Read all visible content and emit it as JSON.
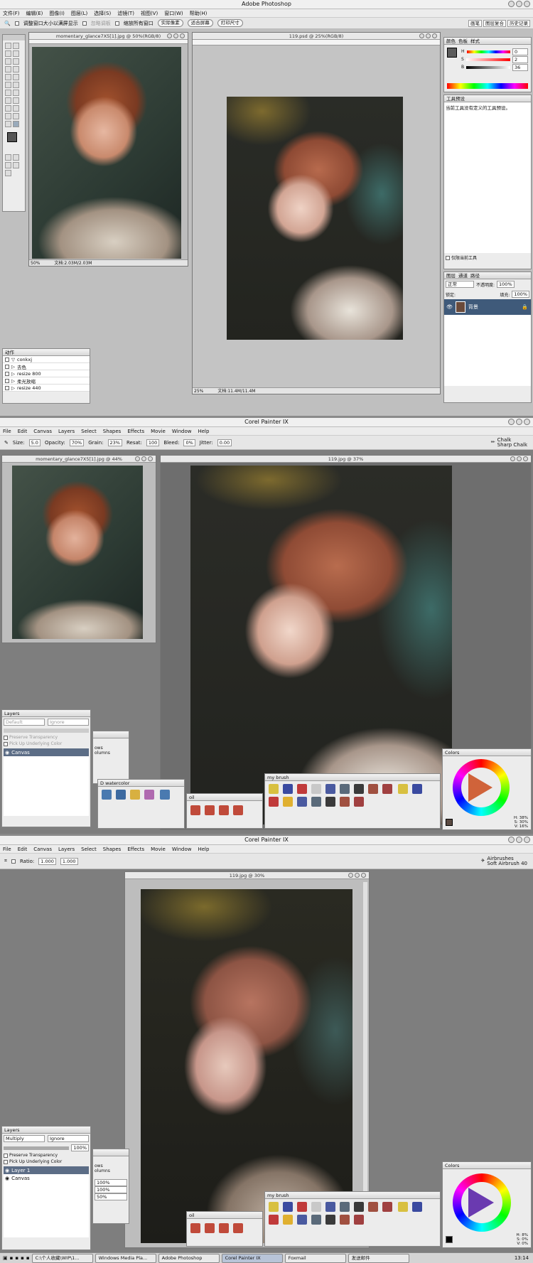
{
  "ps": {
    "title": "Adobe Photoshop",
    "menu": [
      "文件(F)",
      "编辑(E)",
      "图像(I)",
      "图层(L)",
      "选择(S)",
      "滤镜(T)",
      "视图(V)",
      "窗口(W)",
      "帮助(H)"
    ],
    "options": {
      "resize_label": "调整窗口大小以满屏显示",
      "ignore_label": "忽略调板",
      "zoom_all_label": "缩放所有窗口",
      "actual_pixels": "实际像素",
      "fit_screen": "适合屏幕",
      "print_size": "打印尺寸"
    },
    "tabs": [
      "画笔",
      "图层复合",
      "历史记录"
    ],
    "ref_window": {
      "title": "momentary_glance7X5[1].jpg @ 50%(RGB/8)",
      "zoom": "50%",
      "doc": "文档:2.03M/2.03M"
    },
    "main_window": {
      "title": "119.psd @ 25%(RGB/8)",
      "zoom": "25%",
      "doc": "文档:11.4M/11.4M"
    },
    "color_panel": {
      "tabs": [
        "颜色",
        "色板",
        "样式"
      ],
      "h_label": "H",
      "s_label": "S",
      "b_label": "B",
      "h": "0",
      "s": "2",
      "b": "36"
    },
    "tool_preset": {
      "title": "工具预设",
      "message": "当前工具没有定义的工具预设。",
      "current_only": "仅限当前工具"
    },
    "layers_panel": {
      "tabs": [
        "图层",
        "通道",
        "路径"
      ],
      "mode": "正常",
      "opacity_label": "不透明度:",
      "opacity": "100%",
      "fill_label": "填充:",
      "fill": "100%",
      "lock_label": "锁定:",
      "layer_name": "背景"
    },
    "actions_panel": {
      "title": "动作",
      "items": [
        "conkxj",
        "去色",
        "resize 800",
        "柔光放缩",
        "resize 440"
      ]
    }
  },
  "painter1": {
    "title": "Corel Painter IX",
    "menu": [
      "File",
      "Edit",
      "Canvas",
      "Layers",
      "Select",
      "Shapes",
      "Effects",
      "Movie",
      "Window",
      "Help"
    ],
    "props": {
      "size_label": "Size:",
      "size": "5.0",
      "opacity_label": "Opacity:",
      "opacity": "70%",
      "grain_label": "Grain:",
      "grain": "23%",
      "resat_label": "Resat:",
      "resat": "100",
      "bleed_label": "Bleed:",
      "bleed": "0%",
      "jitter_label": "Jitter:",
      "jitter": "0.00"
    },
    "brush": {
      "category": "Chalk",
      "variant": "Sharp Chalk"
    },
    "ref_window": {
      "title": "momentary_glance7X5[1].jpg @ 44%"
    },
    "main_window": {
      "title": "119.jpg @ 37%"
    },
    "layers": {
      "title": "Layers",
      "default": "Default",
      "ignore": "Ignore",
      "preserve": "Preserve Transparency",
      "pick_up": "Pick Up Underlying Color",
      "canvas": "Canvas"
    },
    "mini": {
      "rows": "ows",
      "columns": "olumns"
    },
    "palettes": {
      "watercolor": "D watercolor",
      "oil": "oil",
      "my_brush": "my brush"
    },
    "colors": {
      "title": "Colors",
      "h": "H: 38%",
      "s": "S: 30%",
      "v": "V: 16%"
    }
  },
  "painter2": {
    "title": "Corel Painter IX",
    "menu": [
      "File",
      "Edit",
      "Canvas",
      "Layers",
      "Select",
      "Shapes",
      "Effects",
      "Movie",
      "Window",
      "Help"
    ],
    "props": {
      "ratio_label": "Ratio:",
      "ratio1": "1.000",
      "ratio2": "1.000"
    },
    "brush": {
      "category": "Airbrushes",
      "variant": "Soft Airbrush 40"
    },
    "main_window": {
      "title": "119.jpg @ 30%"
    },
    "layers": {
      "title": "Layers",
      "mode": "Multiply",
      "ignore": "Ignore",
      "opacity": "100%",
      "preserve": "Preserve Transparency",
      "pick_up": "Pick Up Underlying Color",
      "layer1": "Layer 1",
      "canvas": "Canvas"
    },
    "mini": {
      "rows": "ows",
      "columns": "olumns",
      "v1": "100%",
      "v2": "100%",
      "v3": "50%"
    },
    "palettes": {
      "oil": "oil",
      "my_brush": "my brush"
    },
    "colors": {
      "title": "Colors",
      "h": "H: 8%",
      "s": "S: 0%",
      "v": "V: 0%"
    }
  },
  "taskbar": {
    "items": [
      "C:\\个人收藏\\WIP\\1...",
      "Windows Media Pla...",
      "Adobe Photoshop",
      "Corel Painter IX",
      "Foxmail",
      "发送邮件"
    ],
    "clock": "13:14"
  }
}
